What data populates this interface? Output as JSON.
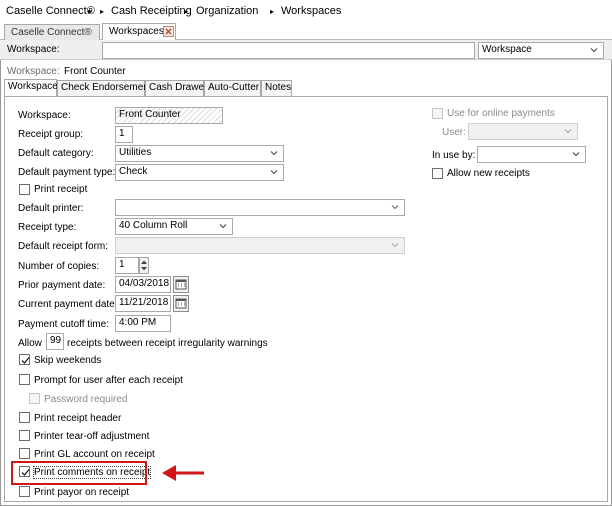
{
  "breadcrumb": {
    "app": "Caselle Connect®",
    "sep": "▸",
    "module": "Cash Receipting",
    "section": "Organization",
    "page": "Workspaces"
  },
  "doc_tabs": {
    "home": "Caselle Connect®",
    "active": "Workspaces"
  },
  "toolbar": {
    "workspace_label": "Workspace:",
    "workspace_value": "",
    "type_select": "Workspace"
  },
  "header": {
    "label": "Workspace:",
    "value": "Front Counter"
  },
  "tabs": [
    "Workspace",
    "Check Endorsement",
    "Cash Drawer",
    "Auto-Cutter",
    "Notes"
  ],
  "form": {
    "workspace_label": "Workspace:",
    "workspace_value": "Front Counter",
    "receipt_group_label": "Receipt group:",
    "receipt_group_value": "1",
    "default_category_label": "Default category:",
    "default_category_value": "Utilities",
    "default_payment_type_label": "Default payment type:",
    "default_payment_type_value": "Check",
    "print_receipt_label": "Print receipt",
    "default_printer_label": "Default printer:",
    "default_printer_value": "",
    "receipt_type_label": "Receipt type:",
    "receipt_type_value": "40 Column Roll",
    "default_receipt_form_label": "Default receipt form:",
    "default_receipt_form_value": "",
    "copies_label": "Number of copies:",
    "copies_value": "1",
    "prior_payment_date_label": "Prior payment date:",
    "prior_payment_date_value": "04/03/2018",
    "current_payment_date_label": "Current payment date:",
    "current_payment_date_value": "11/21/2018",
    "cutoff_label": "Payment cutoff time:",
    "cutoff_value": "4:00 PM",
    "allow_prefix": "Allow",
    "allow_value": "99",
    "allow_suffix": "receipts between receipt irregularity warnings",
    "skip_weekends": "Skip weekends",
    "prompt_user": "Prompt for user after each receipt",
    "password_required": "Password required",
    "print_receipt_header": "Print receipt header",
    "printer_tearoff": "Printer tear-off adjustment",
    "print_gl_account": "Print GL account on receipt",
    "print_comments": "Print comments on receipt",
    "print_payor": "Print payor on receipt"
  },
  "right": {
    "online_payments": "Use for online payments",
    "user_label": "User:",
    "user_value": "",
    "in_use_by_label": "In use by:",
    "in_use_by_value": "",
    "allow_new_receipts": "Allow new receipts"
  },
  "colors": {
    "highlight": "#d0151b",
    "arrow": "#d0151b"
  },
  "icons": {
    "close": "close-icon",
    "chevron": "chevron-down-icon",
    "calendar": "calendar-icon",
    "check": "check-icon",
    "arrow": "arrow-left-icon"
  }
}
